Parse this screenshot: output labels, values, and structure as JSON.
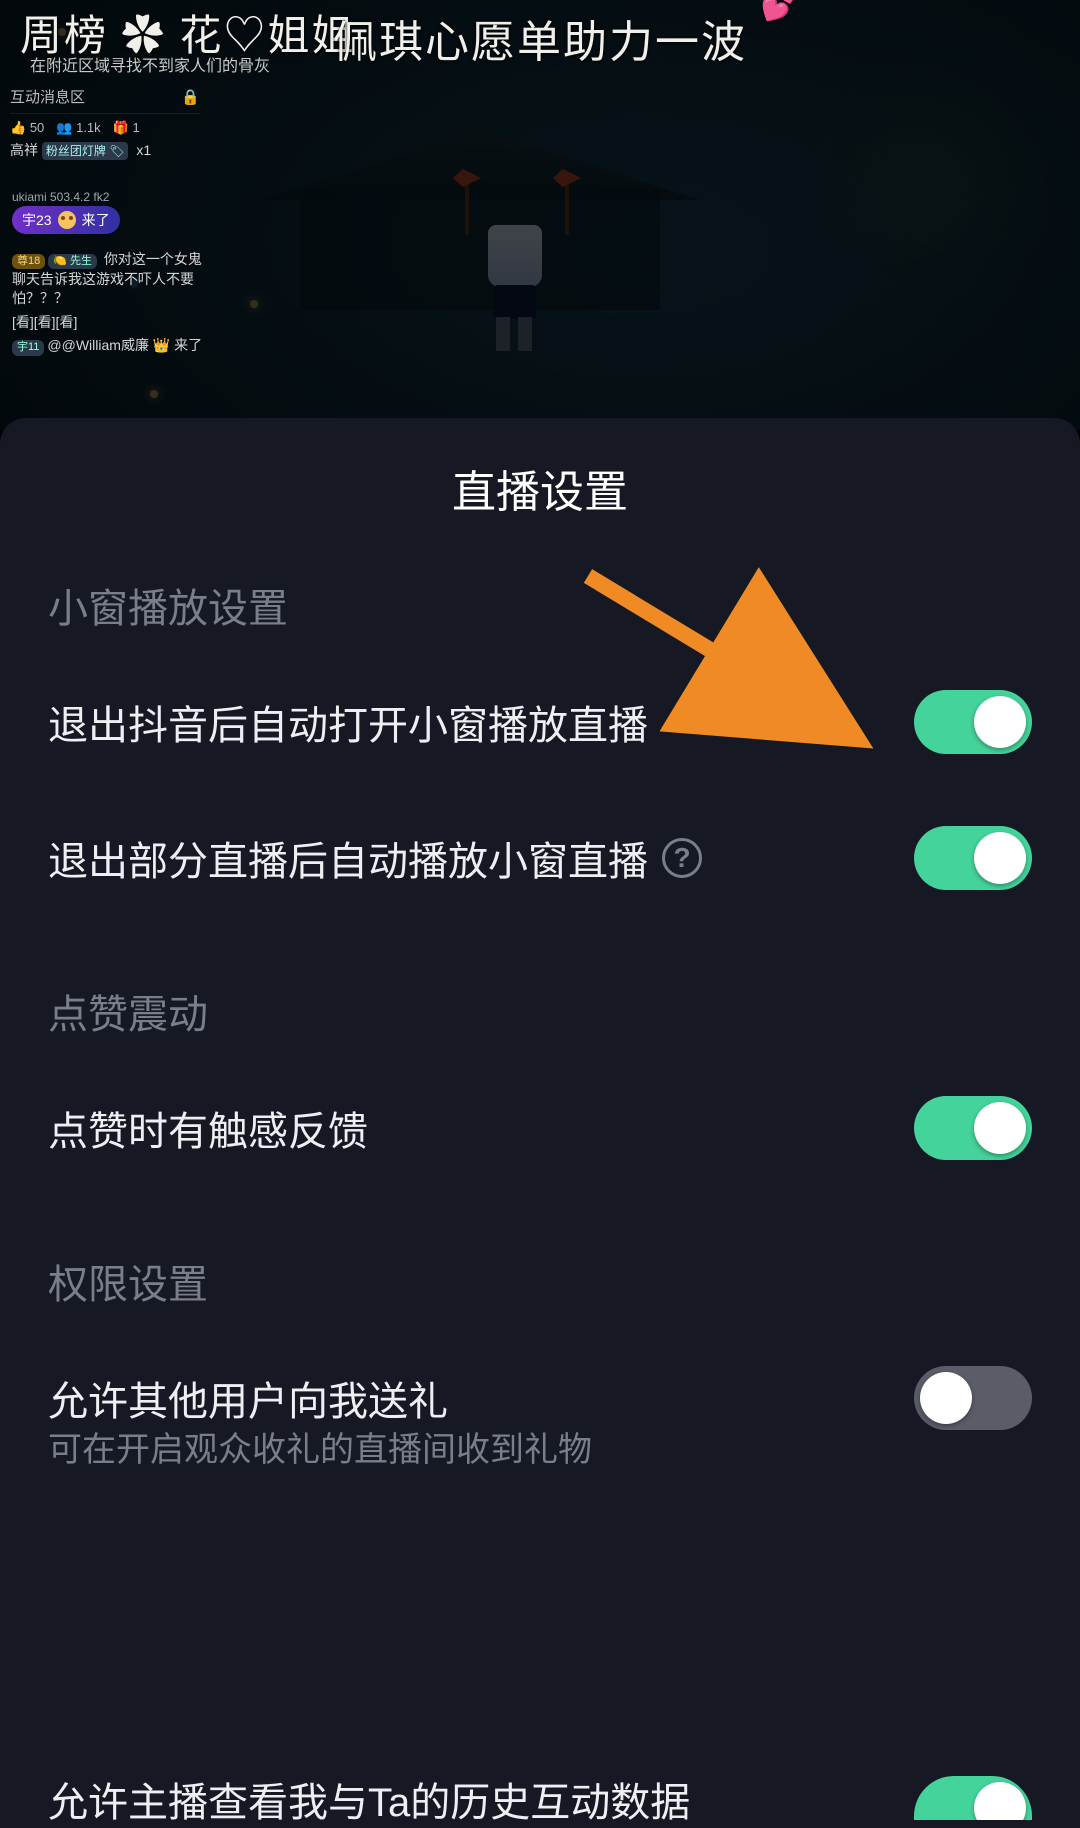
{
  "stream_overlay": {
    "leaderboard_title": "周榜 ✿ 花♡姐姐",
    "leaderboard_sub": "在附近区域寻找不到家人们的骨灰",
    "banner": "佩琪心愿单助力一波",
    "panel_title": "互动消息区",
    "stats": {
      "likes_icon": "👍",
      "likes": "50",
      "viewers_icon": "👥",
      "viewers": "1.1k",
      "gifts_icon": "🎁",
      "gifts": "1"
    },
    "fan_line": {
      "user": "高祥",
      "badge": "粉丝团灯牌 🏷",
      "count": "x1"
    },
    "rank_tag": "ukiami 503.4.2 fk2",
    "arrival_pill": {
      "level": "宇23",
      "text": "来了"
    },
    "chat1_user": "🍋 先生",
    "chat1_text": "你对这一个女鬼聊天告诉我这游戏不吓人不要怕？？？",
    "chat1_tail": "[看][看][看]",
    "chat2_prefix": "@@William威廉",
    "chat2_text": "来了"
  },
  "sheet": {
    "title": "直播设置",
    "section_pip": "小窗播放设置",
    "row_pip_exit_app": "退出抖音后自动打开小窗播放直播",
    "row_pip_exit_room": "退出部分直播后自动播放小窗直播",
    "section_like": "点赞震动",
    "row_like_haptic": "点赞时有触感反馈",
    "section_perm": "权限设置",
    "row_allow_gift": "允许其他用户向我送礼",
    "row_allow_gift_sub": "可在开启观众收礼的直播间收到礼物",
    "row_allow_history": "允许主播查看我与Ta的历史互动数据",
    "help_glyph": "?"
  },
  "toggles": {
    "pip_exit_app": true,
    "pip_exit_room": true,
    "like_haptic": true,
    "allow_gift": false,
    "allow_history": true
  },
  "colors": {
    "accent": "#44d39a",
    "sheet_bg": "#161823",
    "arrow": "#f08a24"
  }
}
